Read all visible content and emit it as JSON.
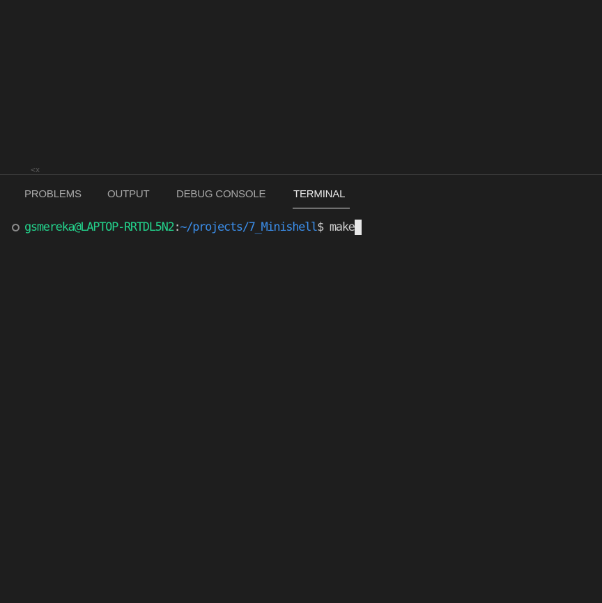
{
  "editor": {
    "fragment_text": "<x"
  },
  "panel": {
    "tabs": [
      {
        "label": "PROBLEMS",
        "active": false
      },
      {
        "label": "OUTPUT",
        "active": false
      },
      {
        "label": "DEBUG CONSOLE",
        "active": false
      },
      {
        "label": "TERMINAL",
        "active": true
      }
    ]
  },
  "terminal": {
    "user_host": "gsmereka@LAPTOP-RRTDL5N2",
    "colon": ":",
    "path": "~/projects/7_Minishell",
    "prompt_symbol": "$ ",
    "command": "make",
    "icons": {
      "decoration": "circle-outline-icon",
      "cursor": "block-cursor"
    }
  },
  "colors": {
    "background": "#1e1e1e",
    "user_host": "#23d18b",
    "path": "#3b8eea",
    "text": "#cccccc",
    "active_tab": "#e7e7e7",
    "inactive_tab": "#a8a8a8"
  }
}
